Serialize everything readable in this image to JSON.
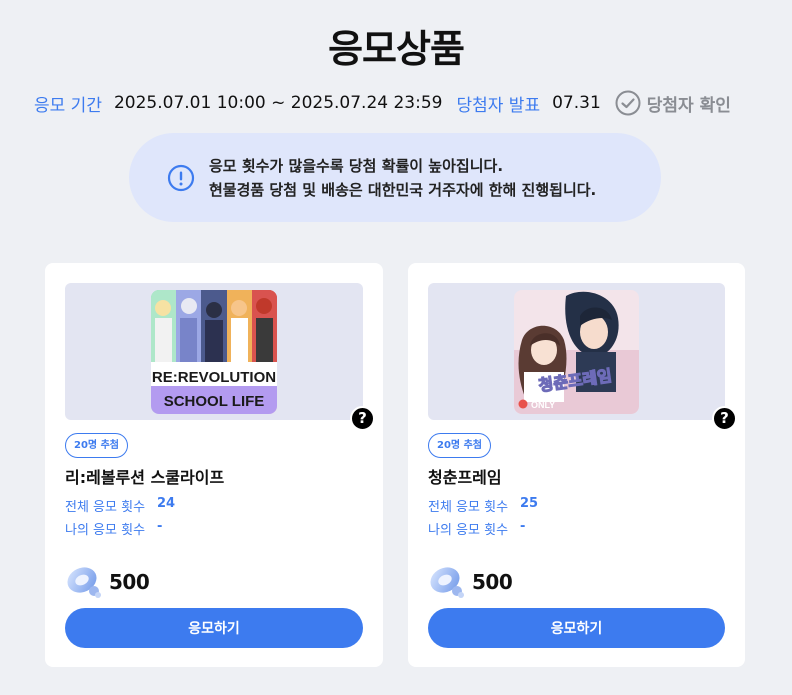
{
  "header": {
    "title": "응모상품"
  },
  "period": {
    "entry_label": "응모 기간",
    "entry_value": "2025.07.01 10:00 ~ 2025.07.24 23:59",
    "announce_label": "당첨자 발표",
    "announce_value": "07.31",
    "check_winner_label": "당첨자 확인"
  },
  "notice": {
    "line1": "응모 횟수가 많을수록 당첨 확률이 높아집니다.",
    "line2": "현물경품 당첨 및 배송은 대한민국 거주자에 한해 진행됩니다."
  },
  "cards": [
    {
      "badge": "20명 추첨",
      "name": "리:레볼루션 스쿨라이프",
      "total_label": "전체 응모 횟수",
      "total_value": "24",
      "mine_label": "나의 응모 횟수",
      "mine_value": "-",
      "price": "500",
      "button": "응모하기",
      "thumb_text_1": "RE:REVOLUTION",
      "thumb_text_2": "SCHOOL LIFE"
    },
    {
      "badge": "20명 추첨",
      "name": "청춘프레임",
      "total_label": "전체 응모 횟수",
      "total_value": "25",
      "mine_label": "나의 응모 횟수",
      "mine_value": "-",
      "price": "500",
      "button": "응모하기",
      "thumb_text_1": "청춘프레임",
      "thumb_tag": "ONLY"
    }
  ],
  "colors": {
    "accent": "#3d7bef",
    "background": "#eef0f4",
    "notice_bg": "#dfe6fb"
  },
  "icons": [
    "check-circle-icon",
    "info-icon",
    "question-icon",
    "coin-icon"
  ]
}
